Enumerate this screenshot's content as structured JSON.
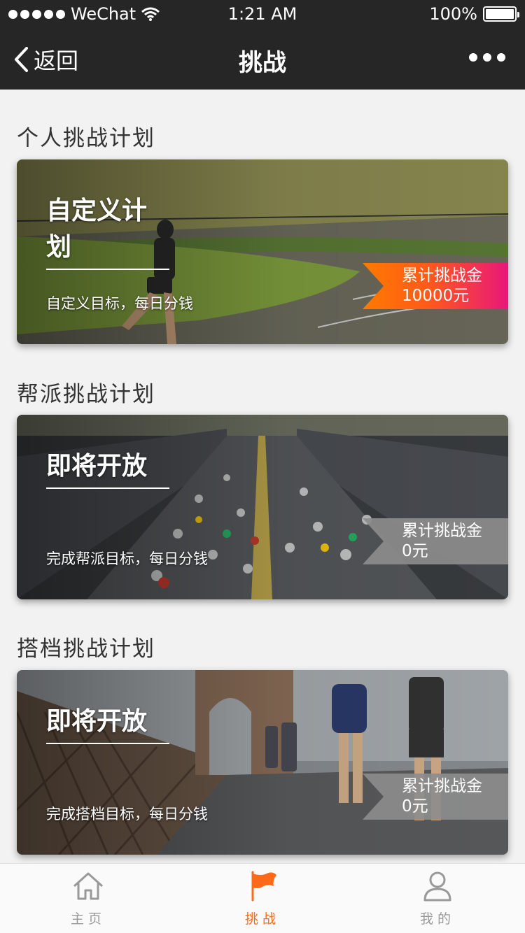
{
  "status_bar": {
    "carrier": "WeChat",
    "time": "1:21 AM",
    "battery": "100%"
  },
  "nav": {
    "back_label": "返回",
    "title": "挑战"
  },
  "sections": [
    {
      "heading": "个人挑战计划",
      "card_title": "自定义计划",
      "card_desc": "自定义目标，每日分钱",
      "ribbon_label": "累计挑战金",
      "ribbon_value": "10000元"
    },
    {
      "heading": "帮派挑战计划",
      "card_title": "即将开放",
      "card_desc": "完成帮派目标，每日分钱",
      "ribbon_label": "累计挑战金",
      "ribbon_value": "0元"
    },
    {
      "heading": "搭档挑战计划",
      "card_title": "即将开放",
      "card_desc": "完成搭档目标，每日分钱",
      "ribbon_label": "累计挑战金",
      "ribbon_value": "0元"
    }
  ],
  "tabbar": {
    "items": [
      {
        "label": "主页",
        "icon": "home-icon",
        "active": false
      },
      {
        "label": "挑战",
        "icon": "flag-icon",
        "active": true
      },
      {
        "label": "我的",
        "icon": "user-icon",
        "active": false
      }
    ]
  },
  "colors": {
    "accent": "#ff6a1a",
    "header_bg": "#262626",
    "page_bg": "#f2f2f2"
  }
}
